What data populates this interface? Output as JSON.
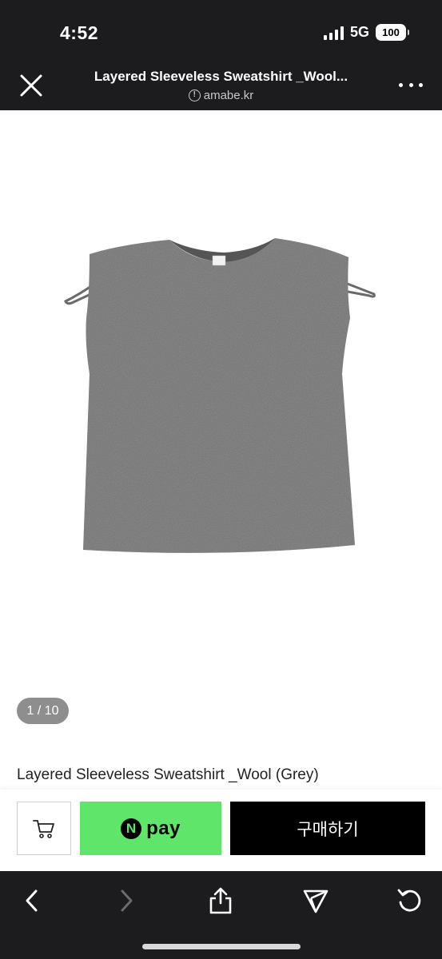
{
  "status_bar": {
    "time": "4:52",
    "network": "5G",
    "battery": "100"
  },
  "header": {
    "title": "Layered Sleeveless Sweatshirt _Wool...",
    "domain": "amabe.kr"
  },
  "gallery": {
    "counter": "1 / 10"
  },
  "product": {
    "name": "Layered Sleeveless Sweatshirt _Wool (Grey)"
  },
  "buy_bar": {
    "npay_badge": "N",
    "npay_label": "pay",
    "purchase_label": "구매하기"
  },
  "icons": [
    "close-icon",
    "info-icon",
    "more-icon",
    "cart-icon",
    "back-icon",
    "forward-icon",
    "share-icon",
    "send-icon",
    "refresh-icon"
  ],
  "colors": {
    "dark_bar": "#1c1c1e",
    "npay_green": "#5ee56a",
    "purchase_black": "#000000",
    "garment_grey": "#6e6e6e"
  }
}
